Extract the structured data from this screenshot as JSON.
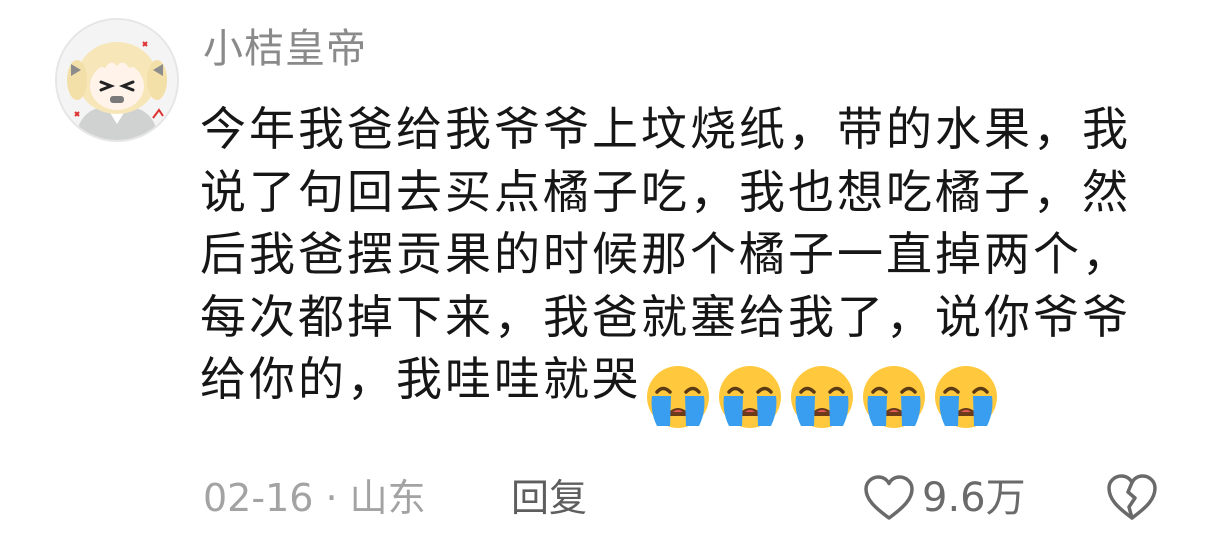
{
  "comment": {
    "username": "小桔皇帝",
    "text": "今年我爸给我爷爷上坟烧纸，带的水果，我说了句回去买点橘子吃，我也想吃橘子，然后我爸摆贡果的时候那个橘子一直掉两个，每次都掉下来，我爸就塞给我了，说你爷爷给你的，我哇哇就哭",
    "emojis": [
      "loudly-crying-face",
      "loudly-crying-face",
      "loudly-crying-face",
      "loudly-crying-face",
      "loudly-crying-face"
    ],
    "date_location": "02-16 · 山东",
    "reply_label": "回复",
    "like_count": "9.6万",
    "icons": {
      "like": "heart-outline-icon",
      "dislike": "broken-heart-icon"
    }
  },
  "colors": {
    "username": "#8a8a8a",
    "text": "#161616",
    "meta": "#a3a3a3",
    "reply": "#5e5e5e",
    "emoji_face": "#ffc83d",
    "emoji_tear": "#3a9ef0"
  }
}
